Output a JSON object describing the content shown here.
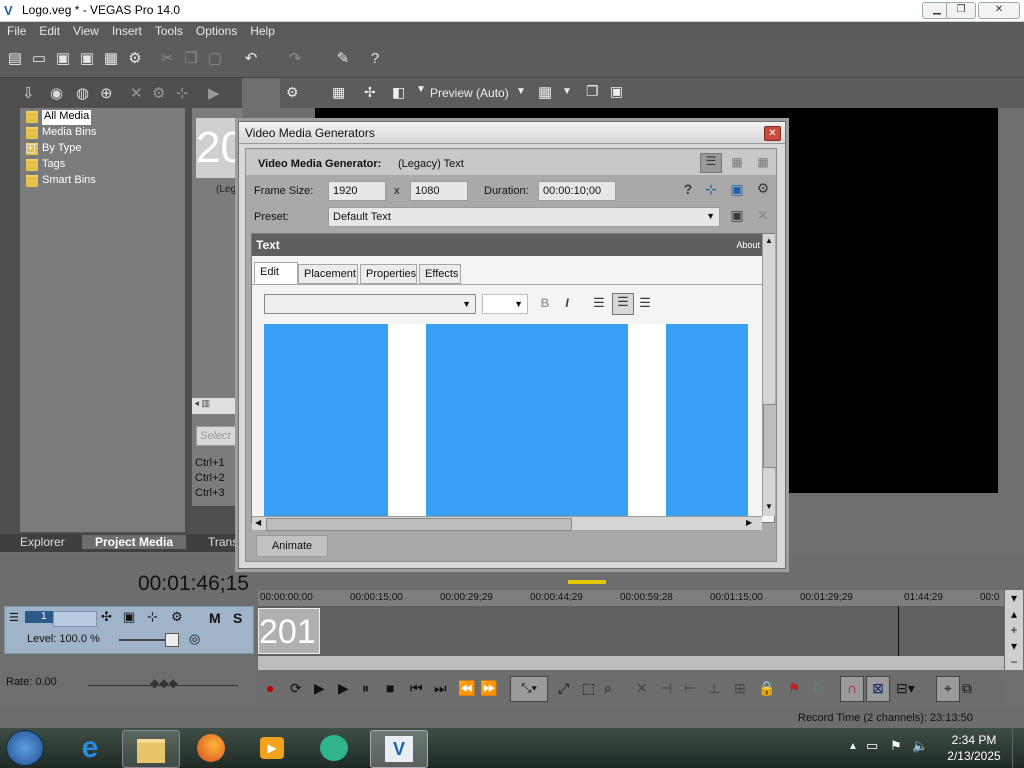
{
  "window": {
    "title": "Logo.veg * - VEGAS Pro 14.0"
  },
  "menu": [
    "File",
    "Edit",
    "View",
    "Insert",
    "Tools",
    "Options",
    "Help"
  ],
  "preview": {
    "mode": "Preview (Auto)"
  },
  "explorer": {
    "items": [
      "All Media",
      "Media Bins",
      "By Type",
      "Tags",
      "Smart Bins"
    ],
    "thumb_text": "20",
    "thumb_caption": "(Leg",
    "search_placeholder": "Select",
    "shortcuts": [
      "Ctrl+1",
      "Ctrl+2",
      "Ctrl+3"
    ],
    "tabs": [
      "Explorer",
      "Project Media",
      "Trans"
    ]
  },
  "dialog": {
    "title": "Video Media Generators",
    "generator_label": "Video Media Generator:",
    "generator_value": "(Legacy) Text",
    "frame_size_label": "Frame Size:",
    "width": "1920",
    "x": "x",
    "height": "1080",
    "duration_label": "Duration:",
    "duration": "00:00:10;00",
    "preset_label": "Preset:",
    "preset": "Default Text",
    "section": "Text",
    "about": "About",
    "tabs": [
      "Edit",
      "Placement",
      "Properties",
      "Effects"
    ],
    "bold": "B",
    "italic": "I",
    "animate": "Animate"
  },
  "timeline": {
    "cursor_time": "00:01:46;15",
    "ruler": [
      "00:00:00;00",
      "00:00:15;00",
      "00:00:29;29",
      "00:00:44;29",
      "00:00:59;28",
      "00:01:15;00",
      "00:01:29;29",
      "01:44;29",
      "00:0"
    ],
    "track_number": "1",
    "level": "Level: 100.0 %",
    "mute": "M",
    "solo": "S",
    "clip_text": "201",
    "rate": "Rate: 0.00",
    "record_time": "Record Time (2 channels): 23:13:50"
  },
  "taskbar": {
    "time": "2:34 PM",
    "date": "2/13/2025"
  }
}
